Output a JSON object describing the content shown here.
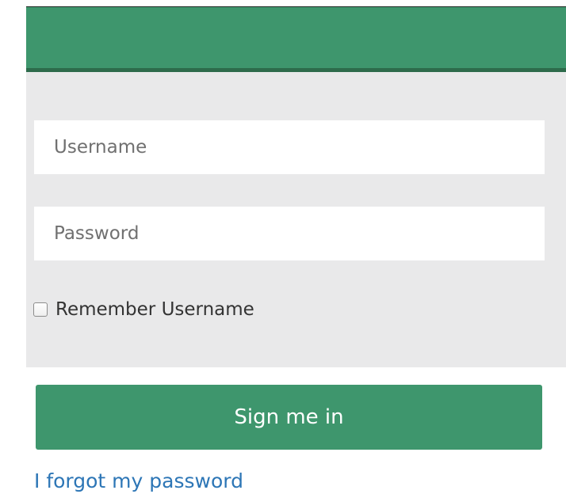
{
  "login": {
    "username_placeholder": "Username",
    "password_placeholder": "Password",
    "remember_label": "Remember Username",
    "remember_checked": false,
    "sign_in_label": "Sign me in",
    "forgot_password_label": "I forgot my password"
  },
  "colors": {
    "header": "#3e966d",
    "header_shadow": "#2d6b4b",
    "panel_background": "#e9e9ea",
    "primary_button": "#3e966d",
    "link": "#2d76b6"
  }
}
